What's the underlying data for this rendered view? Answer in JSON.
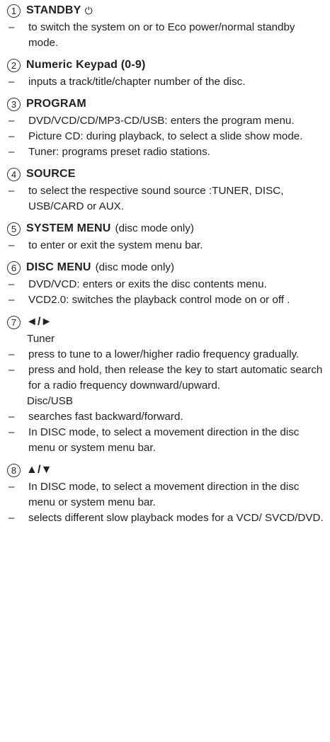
{
  "sections": [
    {
      "number": "1",
      "title": "STANDBY",
      "extra": "",
      "icon": "power-icon",
      "icon_glyph": "⏻",
      "lines": [
        {
          "type": "dash",
          "text": "to switch the system on or to Eco power/normal standby mode."
        }
      ]
    },
    {
      "number": "2",
      "title": "Numeric Keypad (0-9)",
      "extra": "",
      "lines": [
        {
          "type": "dash",
          "text": "inputs a track/title/chapter number of the disc."
        }
      ]
    },
    {
      "number": "3",
      "title": "PROGRAM",
      "extra": "",
      "lines": [
        {
          "type": "dash",
          "text": "DVD/VCD/CD/MP3-CD/USB: enters the program menu."
        },
        {
          "type": "dash",
          "text": "Picture CD: during playback, to select a slide show mode."
        },
        {
          "type": "dash",
          "text": "Tuner: programs preset radio stations."
        }
      ]
    },
    {
      "number": "4",
      "title": "SOURCE",
      "extra": "",
      "lines": [
        {
          "type": "dash",
          "text": "to select the respective sound source :TUNER, DISC, USB/CARD or AUX."
        }
      ]
    },
    {
      "number": "5",
      "title": "SYSTEM MENU",
      "extra": "(disc mode only)",
      "lines": [
        {
          "type": "dash",
          "text": "to enter or exit the system menu bar."
        }
      ]
    },
    {
      "number": "6",
      "title": "DISC MENU",
      "extra": "(disc mode only)",
      "lines": [
        {
          "type": "dash",
          "text": "DVD/VCD: enters or exits the disc contents menu."
        },
        {
          "type": "dash",
          "text": "VCD2.0: switches the playback control mode on or off ."
        }
      ]
    },
    {
      "number": "7",
      "title": "◄/►",
      "extra": "",
      "lines": [
        {
          "type": "plain",
          "text": "Tuner"
        },
        {
          "type": "dash",
          "text": "press to tune to a lower/higher radio frequency gradually."
        },
        {
          "type": "dash",
          "text": "press and hold, then release the key to start automatic search for a radio frequency downward/upward."
        },
        {
          "type": "plain",
          "text": "Disc/USB"
        },
        {
          "type": "dash",
          "text": "searches fast backward/forward."
        },
        {
          "type": "dash",
          "text": "In DISC mode, to select a movement direction in the disc menu or system menu bar."
        }
      ]
    },
    {
      "number": "8",
      "title": "▲/▼",
      "extra": "",
      "lines": [
        {
          "type": "dash",
          "text": "In DISC mode, to select a movement direction in the disc menu or system menu bar."
        },
        {
          "type": "dash",
          "text": "selects different slow playback modes for a VCD/ SVCD/DVD."
        }
      ]
    }
  ],
  "dash_char": "–"
}
